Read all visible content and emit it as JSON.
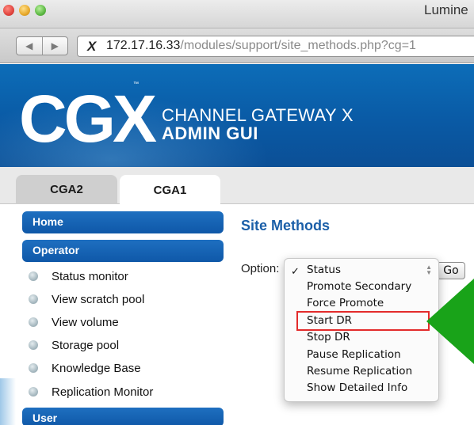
{
  "window": {
    "title": "Lumine",
    "url_host": "172.17.16.33",
    "url_path": "/modules/support/site_methods.php?cg=1",
    "back_label": "◀",
    "forward_label": "▶",
    "favicon": "X"
  },
  "banner": {
    "logo_text": "CGX",
    "trademark": "™",
    "line1": "CHANNEL GATEWAY X",
    "line2": "ADMIN GUI"
  },
  "tabs": [
    {
      "label": "CGA2",
      "active": false
    },
    {
      "label": "CGA1",
      "active": true
    }
  ],
  "sidebar": {
    "home": "Home",
    "operator": "Operator",
    "items": [
      {
        "label": "Status monitor"
      },
      {
        "label": "View scratch pool"
      },
      {
        "label": "View volume"
      },
      {
        "label": "Storage pool"
      },
      {
        "label": "Knowledge Base"
      },
      {
        "label": "Replication Monitor"
      }
    ],
    "user": "User"
  },
  "main": {
    "title": "Site Methods",
    "option_label": "Option:",
    "go_label": "Go",
    "check_mark": "✓",
    "options": [
      "Status",
      "Promote Secondary",
      "Force Promote",
      "Start DR",
      "Stop DR",
      "Pause Replication",
      "Resume Replication",
      "Show Detailed Info"
    ],
    "selected_option": "Status",
    "highlighted_option": "Start DR"
  },
  "colors": {
    "banner_blue": "#0a5aa5",
    "section_blue": "#1565b8",
    "title_blue": "#1b5fa8",
    "highlight_red": "#e32b2b",
    "arrow_green": "#19a319"
  }
}
